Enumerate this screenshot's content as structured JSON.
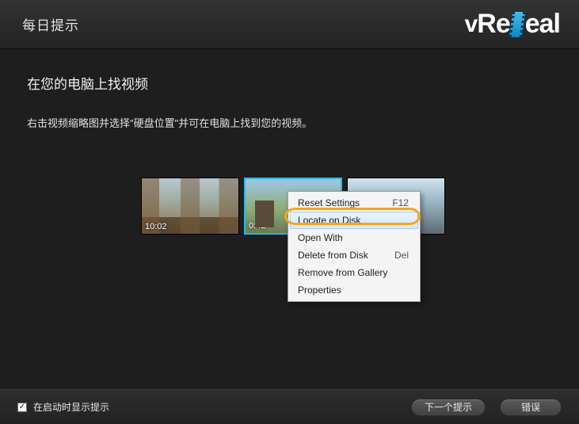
{
  "header": {
    "title": "每日提示",
    "logo_text": "vReVeal"
  },
  "content": {
    "section_title": "在您的电脑上找视频",
    "section_desc": "右击视频缩略图并选择\"硬盘位置\"并可在电脑上找到您的视频。"
  },
  "thumbnails": [
    {
      "duration": "10:02",
      "selected": false
    },
    {
      "duration": "0:42",
      "selected": true
    },
    {
      "duration": "",
      "selected": false
    }
  ],
  "context_menu": {
    "items": [
      {
        "label": "Reset Settings",
        "shortcut": "F12",
        "highlighted": false
      },
      {
        "label": "Locate on Disk",
        "shortcut": "",
        "highlighted": true
      },
      {
        "label": "Open With",
        "shortcut": "",
        "highlighted": false
      },
      {
        "label": "Delete from Disk",
        "shortcut": "Del",
        "highlighted": false
      },
      {
        "label": "Remove from Gallery",
        "shortcut": "",
        "highlighted": false
      },
      {
        "label": "Properties",
        "shortcut": "",
        "highlighted": false
      }
    ]
  },
  "footer": {
    "checkbox_label": "在启动时显示提示",
    "checked": true,
    "next_tip": "下一个提示",
    "error": "错误"
  }
}
